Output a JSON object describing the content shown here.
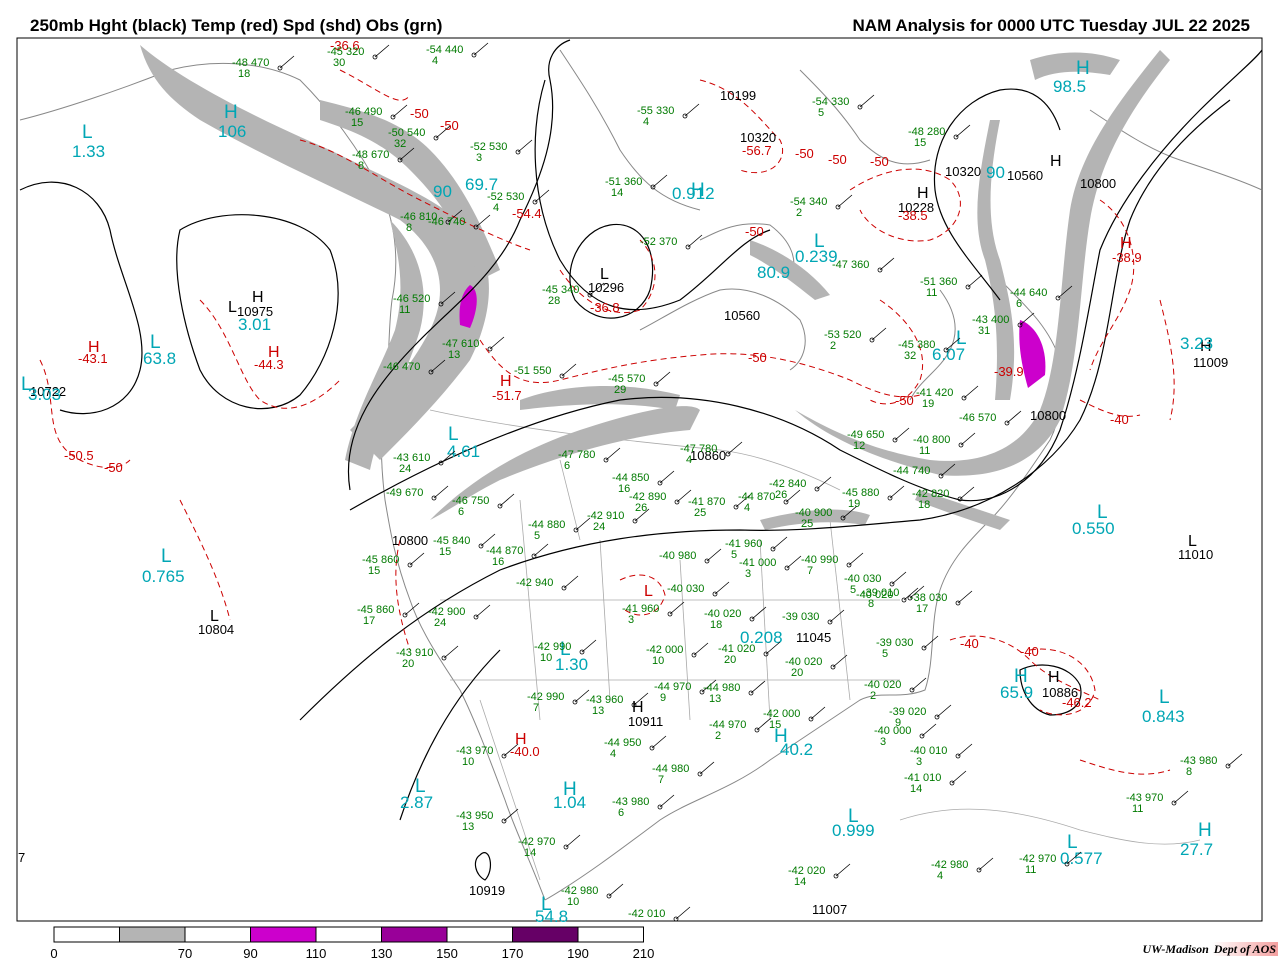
{
  "header": {
    "title_left": "250mb Hght (black) Temp (red) Spd (shd) Obs (grn)",
    "title_right": "NAM Analysis for 0000 UTC Tuesday  JUL 22 2025"
  },
  "legend": {
    "bins": [
      {
        "color": "#ffffff"
      },
      {
        "color": "#b4b4b4"
      },
      {
        "color": "#ffffff"
      },
      {
        "color": "#cc00cc"
      },
      {
        "color": "#ffffff"
      },
      {
        "color": "#990099"
      },
      {
        "color": "#ffffff"
      },
      {
        "color": "#660066"
      },
      {
        "color": "#ffffff"
      }
    ],
    "ticks": [
      "0",
      "70",
      "90",
      "110",
      "130",
      "150",
      "170",
      "190",
      "210"
    ]
  },
  "credit": {
    "org": "UW-Madison",
    "dept": "Dept of AOS"
  },
  "colors": {
    "height": "#000000",
    "temp": "#cc0000",
    "speed": "#00a6b4",
    "obs": "#007a00",
    "shade_low": "#b4b4b4",
    "shade_mid": "#cc00cc",
    "border": "#888888"
  },
  "height_labels": [
    "10199",
    "10320",
    "10228",
    "10320",
    "10560",
    "10800",
    "10975",
    "10722",
    "10296",
    "10560",
    "10800",
    "10860",
    "10800",
    "11009",
    "11010",
    "10804",
    "10911",
    "10886",
    "10919",
    "11007",
    "11045"
  ],
  "height_centers": [
    "H",
    "L",
    "L",
    "H",
    "H",
    "H",
    "L",
    "L",
    "H",
    "H"
  ],
  "temp_labels": [
    "-36.6",
    "-50",
    "-50",
    "-54.4",
    "-36.8",
    "-56.7",
    "-50",
    "-50",
    "-50",
    "-38.5",
    "-50",
    "-50",
    "-38.9",
    "-43.1",
    "-44.3",
    "-50.5",
    "-50",
    "-51.7",
    "-50",
    "-40",
    "-40",
    "-46.2",
    "-40.0",
    "-40",
    "-39.9"
  ],
  "temp_centers": [
    "H",
    "H",
    "H",
    "H",
    "L",
    "H"
  ],
  "speed_labels": [
    "1.33",
    "106",
    "90",
    "69.7",
    "0.912",
    "0.239",
    "80.9",
    "3.01",
    "63.8",
    "3.03",
    "4.61",
    "6.07",
    "90",
    "98.5",
    "3.23",
    "0.550",
    "0.765",
    "1.30",
    "0.208",
    "65.9",
    "0.843",
    "40.2",
    "2.87",
    "1.04",
    "0.999",
    "27.7",
    "0.577",
    "54.8"
  ],
  "speed_centers": [
    "L",
    "H",
    "L",
    "H",
    "L",
    "L",
    "L",
    "L",
    "L",
    "H",
    "L",
    "L",
    "L",
    "L",
    "L",
    "L",
    "H",
    "H",
    "H",
    "L",
    "H"
  ],
  "stations": [
    {
      "t": "-48",
      "h": "470",
      "d": "18"
    },
    {
      "t": "-45",
      "h": "320",
      "d": "30"
    },
    {
      "t": "-54",
      "h": "440",
      "d": "4"
    },
    {
      "t": "-46",
      "h": "490",
      "d": "15"
    },
    {
      "t": "-50",
      "h": "540",
      "d": "32"
    },
    {
      "t": "-48",
      "h": "670",
      "d": "8"
    },
    {
      "t": "-52",
      "h": "530",
      "d": "3"
    },
    {
      "t": "-51",
      "h": "360",
      "d": "14"
    },
    {
      "t": "-52",
      "h": "530",
      "d": "4"
    },
    {
      "t": "-55",
      "h": "330",
      "d": "4"
    },
    {
      "t": "-54",
      "h": "330",
      "d": "5"
    },
    {
      "t": "-48",
      "h": "280",
      "d": "15"
    },
    {
      "t": "-54",
      "h": "340",
      "d": "2"
    },
    {
      "t": "-46",
      "h": "810",
      "d": "8"
    },
    {
      "t": "-46",
      "h": "740",
      "d": ""
    },
    {
      "t": "-52",
      "h": "370",
      "d": ""
    },
    {
      "t": "-45",
      "h": "340",
      "d": "28"
    },
    {
      "t": "-47",
      "h": "360",
      "d": ""
    },
    {
      "t": "-51",
      "h": "360",
      "d": "11"
    },
    {
      "t": "-44",
      "h": "640",
      "d": "6"
    },
    {
      "t": "-46",
      "h": "520",
      "d": "11"
    },
    {
      "t": "-47",
      "h": "610",
      "d": "13"
    },
    {
      "t": "-53",
      "h": "520",
      "d": "2"
    },
    {
      "t": "-43",
      "h": "400",
      "d": "31"
    },
    {
      "t": "-45",
      "h": "380",
      "d": "32"
    },
    {
      "t": "-46",
      "h": "470",
      "d": ""
    },
    {
      "t": "-51",
      "h": "550",
      "d": ""
    },
    {
      "t": "-45",
      "h": "570",
      "d": "29"
    },
    {
      "t": "-41",
      "h": "420",
      "d": "19"
    },
    {
      "t": "-46",
      "h": "570",
      "d": ""
    },
    {
      "t": "-43",
      "h": "610",
      "d": "24"
    },
    {
      "t": "-47",
      "h": "780",
      "d": "6"
    },
    {
      "t": "-47",
      "h": "780",
      "d": "4"
    },
    {
      "t": "-49",
      "h": "650",
      "d": "12"
    },
    {
      "t": "-40",
      "h": "800",
      "d": "11"
    },
    {
      "t": "-44",
      "h": "740",
      "d": ""
    },
    {
      "t": "-49",
      "h": "670",
      "d": ""
    },
    {
      "t": "-44",
      "h": "850",
      "d": "16"
    },
    {
      "t": "-42",
      "h": "890",
      "d": "26"
    },
    {
      "t": "-41",
      "h": "870",
      "d": "25"
    },
    {
      "t": "-44",
      "h": "870",
      "d": "4"
    },
    {
      "t": "-42",
      "h": "840",
      "d": "26"
    },
    {
      "t": "-46",
      "h": "750",
      "d": "6"
    },
    {
      "t": "-42",
      "h": "910",
      "d": "24"
    },
    {
      "t": "-40",
      "h": "900",
      "d": "25"
    },
    {
      "t": "-45",
      "h": "880",
      "d": "19"
    },
    {
      "t": "-42",
      "h": "820",
      "d": "18"
    },
    {
      "t": "-45",
      "h": "840",
      "d": "15"
    },
    {
      "t": "-44",
      "h": "870",
      "d": "16"
    },
    {
      "t": "-44",
      "h": "880",
      "d": "5"
    },
    {
      "t": "-45",
      "h": "860",
      "d": "15"
    },
    {
      "t": "-40",
      "h": "980",
      "d": ""
    },
    {
      "t": "-41",
      "h": "960",
      "d": "5"
    },
    {
      "t": "-41",
      "h": "000",
      "d": "3"
    },
    {
      "t": "-40",
      "h": "990",
      "d": "7"
    },
    {
      "t": "-42",
      "h": "940",
      "d": ""
    },
    {
      "t": "-41",
      "h": "960",
      "d": "3"
    },
    {
      "t": "-40",
      "h": "030",
      "d": ""
    },
    {
      "t": "-40",
      "h": "020",
      "d": "18"
    },
    {
      "t": "-39",
      "h": "030",
      "d": ""
    },
    {
      "t": "-40",
      "h": "030",
      "d": "5"
    },
    {
      "t": "-40",
      "h": "020",
      "d": ""
    },
    {
      "t": "-39",
      "h": "010",
      "d": "8"
    },
    {
      "t": "-38",
      "h": "030",
      "d": "17"
    },
    {
      "t": "-45",
      "h": "860",
      "d": "17"
    },
    {
      "t": "-42",
      "h": "900",
      "d": "24"
    },
    {
      "t": "-43",
      "h": "910",
      "d": "20"
    },
    {
      "t": "-42",
      "h": "990",
      "d": "10"
    },
    {
      "t": "-42",
      "h": "000",
      "d": "10"
    },
    {
      "t": "-41",
      "h": "020",
      "d": "20"
    },
    {
      "t": "-40",
      "h": "020",
      "d": "20"
    },
    {
      "t": "-39",
      "h": "030",
      "d": "5"
    },
    {
      "t": "-40",
      "h": "020",
      "d": "2"
    },
    {
      "t": "-39",
      "h": "020",
      "d": "9"
    },
    {
      "t": "-40",
      "h": "000",
      "d": "3"
    },
    {
      "t": "-42",
      "h": "990",
      "d": "7"
    },
    {
      "t": "-43",
      "h": "960",
      "d": "13"
    },
    {
      "t": "-44",
      "h": "970",
      "d": "9"
    },
    {
      "t": "-44",
      "h": "980",
      "d": "13"
    },
    {
      "t": "-42",
      "h": "000",
      "d": "15"
    },
    {
      "t": "-44",
      "h": "970",
      "d": "2"
    },
    {
      "t": "-44",
      "h": "950",
      "d": "4"
    },
    {
      "t": "-43",
      "h": "970",
      "d": "10"
    },
    {
      "t": "-44",
      "h": "980",
      "d": "7"
    },
    {
      "t": "-43",
      "h": "980",
      "d": "6"
    },
    {
      "t": "-40",
      "h": "010",
      "d": "3"
    },
    {
      "t": "-41",
      "h": "010",
      "d": "14"
    },
    {
      "t": "-43",
      "h": "950",
      "d": "13"
    },
    {
      "t": "-42",
      "h": "970",
      "d": "14"
    },
    {
      "t": "-42",
      "h": "020",
      "d": "14"
    },
    {
      "t": "-42",
      "h": "980",
      "d": "4"
    },
    {
      "t": "-42",
      "h": "970",
      "d": "11"
    },
    {
      "t": "-43",
      "h": "980",
      "d": "8"
    },
    {
      "t": "-43",
      "h": "970",
      "d": "11"
    },
    {
      "t": "-42",
      "h": "980",
      "d": "10"
    },
    {
      "t": "-42",
      "h": "010",
      "d": ""
    }
  ],
  "edge_mark": "7"
}
